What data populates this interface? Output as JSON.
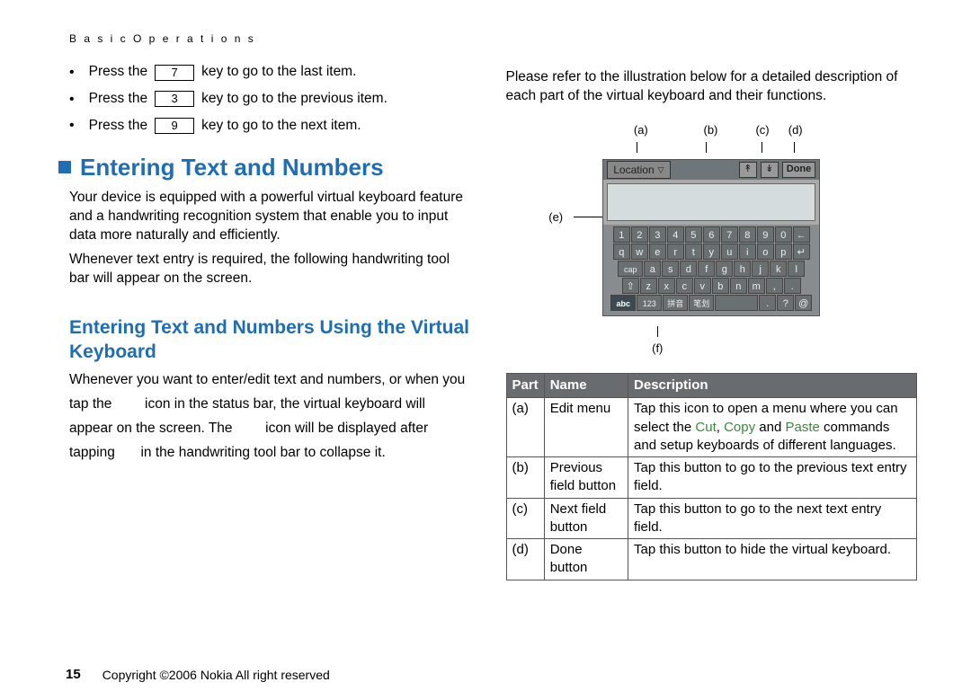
{
  "header": "B a s i c   O p e r a t i o n s",
  "left": {
    "bullets": [
      {
        "pre": "Press the",
        "key": "7",
        "post": "key to go to the last item."
      },
      {
        "pre": "Press the",
        "key": "3",
        "post": "key to go to the previous item."
      },
      {
        "pre": "Press the",
        "key": "9",
        "post": "key to go to the next item."
      }
    ],
    "h2": "Entering Text and Numbers",
    "p1": "Your device is equipped with a powerful virtual keyboard feature and a handwriting recognition system that enable you to input data more naturally and efficiently.",
    "p2": "Whenever text entry is required, the following handwriting tool bar will appear on the screen.",
    "h3": "Entering Text and Numbers Using the Virtual Keyboard",
    "p3a": "Whenever you want to enter/edit text and numbers, or when you",
    "p3b_pre": "tap the",
    "p3b_post": "icon in the status bar, the virtual keyboard will",
    "p3c_pre": "appear on the screen. The",
    "p3c_post": "icon will be displayed after",
    "p3d_pre": "tapping",
    "p3d_post": "in the handwriting tool bar to collapse it."
  },
  "right": {
    "intro": "Please refer to the illustration below for a detailed description of each part of the virtual keyboard and their functions.",
    "labels": {
      "a": "(a)",
      "b": "(b)",
      "c": "(c)",
      "d": "(d)",
      "e": "(e)",
      "f": "(f)"
    },
    "vk": {
      "location": "Location",
      "done": "Done",
      "rows": [
        [
          "1",
          "2",
          "3",
          "4",
          "5",
          "6",
          "7",
          "8",
          "9",
          "0",
          "←"
        ],
        [
          "q",
          "w",
          "e",
          "r",
          "t",
          "y",
          "u",
          "i",
          "o",
          "p",
          "↵"
        ],
        [
          "cap",
          "a",
          "s",
          "d",
          "f",
          "g",
          "h",
          "j",
          "k",
          "l"
        ],
        [
          "⇧",
          "z",
          "x",
          "c",
          "v",
          "b",
          "n",
          "m",
          ",",
          "."
        ],
        [
          "abc",
          "123",
          "拼音",
          "笔划",
          "",
          ".",
          "?",
          "@"
        ]
      ]
    },
    "table": {
      "headers": {
        "part": "Part",
        "name": "Name",
        "desc": "Description"
      },
      "rows": [
        {
          "part": "(a)",
          "name": "Edit menu",
          "desc_pre": "Tap this icon to open a menu where you can select the ",
          "g1": "Cut",
          "s1": ", ",
          "g2": "Copy",
          "s2": " and ",
          "g3": "Paste",
          "desc_post": " commands and setup keyboards of different languages."
        },
        {
          "part": "(b)",
          "name": "Previous field button",
          "desc": "Tap this button to go to the previous text entry field."
        },
        {
          "part": "(c)",
          "name": "Next field button",
          "desc": "Tap this button to go to the next text entry field."
        },
        {
          "part": "(d)",
          "name": "Done button",
          "desc": "Tap this button to hide the virtual keyboard."
        }
      ]
    }
  },
  "footer": {
    "page": "15",
    "copyright": "Copyright ©2006 Nokia All right reserved"
  }
}
